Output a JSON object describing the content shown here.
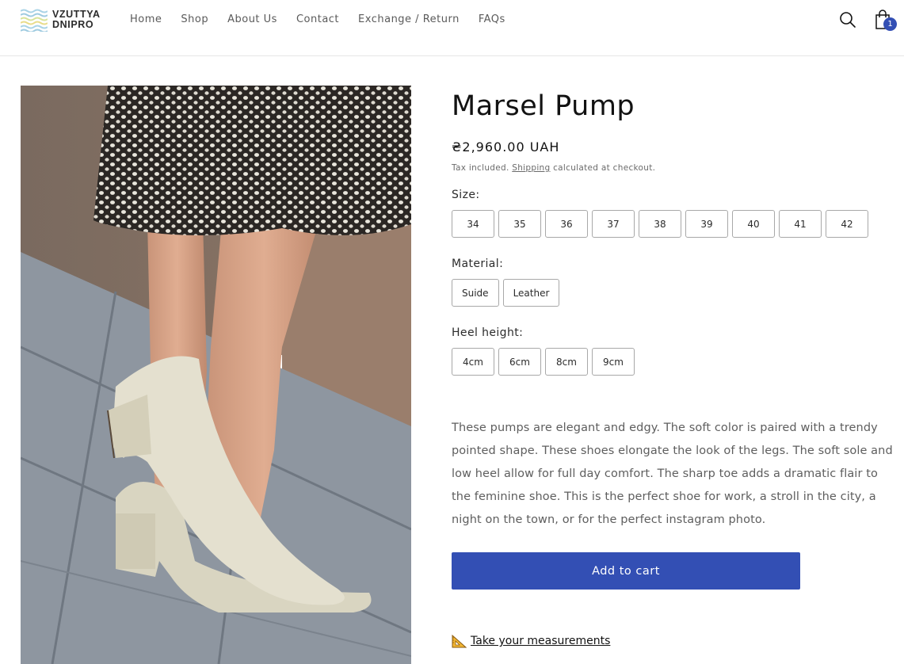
{
  "header": {
    "logo": {
      "line1": "VZUTTYA",
      "line2": "DNIPRO"
    },
    "nav": [
      {
        "label": "Home"
      },
      {
        "label": "Shop"
      },
      {
        "label": "About Us"
      },
      {
        "label": "Contact"
      },
      {
        "label": "Exchange / Return"
      },
      {
        "label": "FAQs"
      }
    ],
    "icons": {
      "search": "search-icon",
      "cart": "bag-icon"
    },
    "cart_count": "1",
    "accent_color": "#334fb4"
  },
  "product": {
    "title": "Marsel Pump",
    "price": "₴2,960.00 UAH",
    "tax_prefix": "Tax included. ",
    "shipping_link": "Shipping",
    "tax_suffix": " calculated at checkout.",
    "options": {
      "size": {
        "label": "Size:",
        "values": [
          "34",
          "35",
          "36",
          "37",
          "38",
          "39",
          "40",
          "41",
          "42"
        ]
      },
      "material": {
        "label": "Material:",
        "values": [
          "Suide",
          "Leather"
        ]
      },
      "heel": {
        "label": "Heel height:",
        "values": [
          "4cm",
          "6cm",
          "8cm",
          "9cm"
        ]
      }
    },
    "description": "These pumps are elegant and edgy. The soft color is paired with a trendy pointed shape. These shoes elongate the look of the legs. The soft sole and low heel allow for full day comfort. The sharp toe adds a dramatic flair to the feminine shoe. This is the perfect shoe for work, a stroll in the city, a night on the town, or for the perfect instagram photo.",
    "add_to_cart": "Add to cart",
    "measurements_link": "Take your measurements",
    "measure_icon": "triangular-ruler-icon"
  }
}
